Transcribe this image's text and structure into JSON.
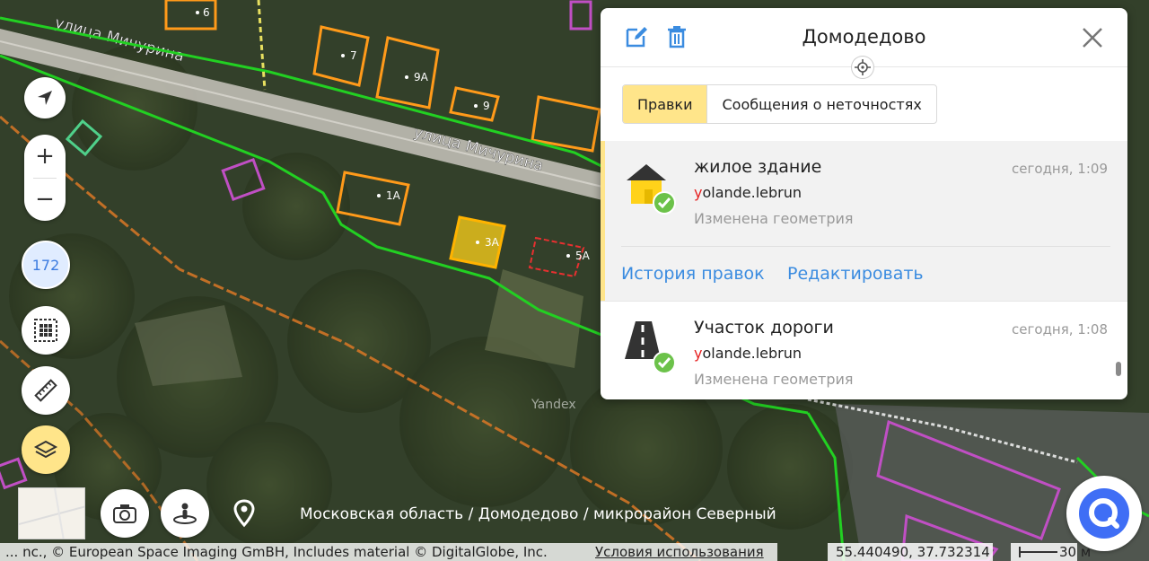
{
  "map": {
    "streets": [
      {
        "name": "улица Мичурина"
      },
      {
        "name": "улица Мичурина"
      }
    ],
    "house_labels": [
      "6",
      "7",
      "9А",
      "9",
      "1А",
      "3А",
      "5А"
    ],
    "watermark": "Yandex"
  },
  "controls": {
    "locate_icon": "navigation-arrow",
    "zoom_in_label": "+",
    "zoom_out_label": "−",
    "counter": "172",
    "grid_icon": "grid",
    "ruler_icon": "ruler",
    "layers_icon": "layers",
    "photo_icon": "camera",
    "panorama_icon": "person-360",
    "pin_icon": "place-marker"
  },
  "panel": {
    "title": "Домодедово",
    "tabs": [
      "Правки",
      "Сообщения о неточностях"
    ],
    "active_tab": 0,
    "items": [
      {
        "title": "жилое здание",
        "user_first": "y",
        "user_rest": "olande.lebrun",
        "description": "Изменена геометрия",
        "time": "сегодня, 1:09",
        "icon": "house-icon"
      },
      {
        "title": "Участок дороги",
        "user_first": "y",
        "user_rest": "olande.lebrun",
        "description": "Изменена геометрия",
        "time": "сегодня, 1:08",
        "icon": "road-icon"
      }
    ],
    "links": {
      "history": "История правок",
      "edit": "Редактировать"
    }
  },
  "footer": {
    "breadcrumb": "Московская область / Домодедово / микрорайон Северный",
    "copyright": "... nc., © European Space Imaging GmBH, Includes material © DigitalGlobe, Inc.",
    "terms": "Условия использования",
    "coordinates": "55.440490, 37.732314",
    "scale": "30 м"
  },
  "colors": {
    "accent": "#ffe58a",
    "link": "#3b8ce0",
    "check": "#6cc24a",
    "region_line": "#22d022",
    "house_outline": "#ff9a1a",
    "selected_fill": "#ffd21a",
    "other_outline": "#c04fc4",
    "chat_button": "#3f6ef5"
  }
}
